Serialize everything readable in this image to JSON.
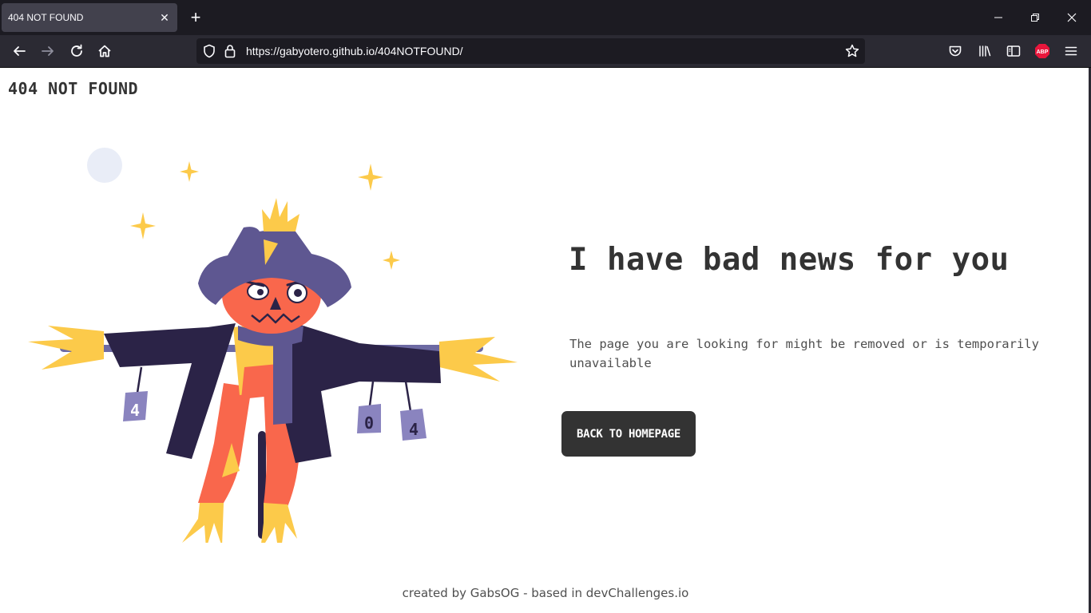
{
  "browser": {
    "tab_title": "404 NOT FOUND",
    "url": "https://gabyotero.github.io/404NOTFOUND/",
    "adblock_label": "ABP"
  },
  "page": {
    "logo": "404 NOT FOUND",
    "headline": "I have bad news for you",
    "description": "The page you are looking for might be removed or is temporarily unavailable",
    "button_label": "BACK TO HOMEPAGE",
    "footer": "created by GabsOG - based in devChallenges.io",
    "can_labels": [
      "4",
      "0",
      "4"
    ]
  },
  "colors": {
    "accent_dark": "#333333",
    "hat": "#5e5791",
    "coat": "#2b2347",
    "pumpkin": "#f9674c",
    "straw": "#fcca4a",
    "moon": "#e9edf7"
  },
  "icons": [
    "back-icon",
    "forward-icon",
    "reload-icon",
    "home-icon",
    "shield-icon",
    "lock-icon",
    "star-icon",
    "pocket-icon",
    "library-icon",
    "sidebar-icon",
    "abp-icon",
    "menu-icon"
  ]
}
